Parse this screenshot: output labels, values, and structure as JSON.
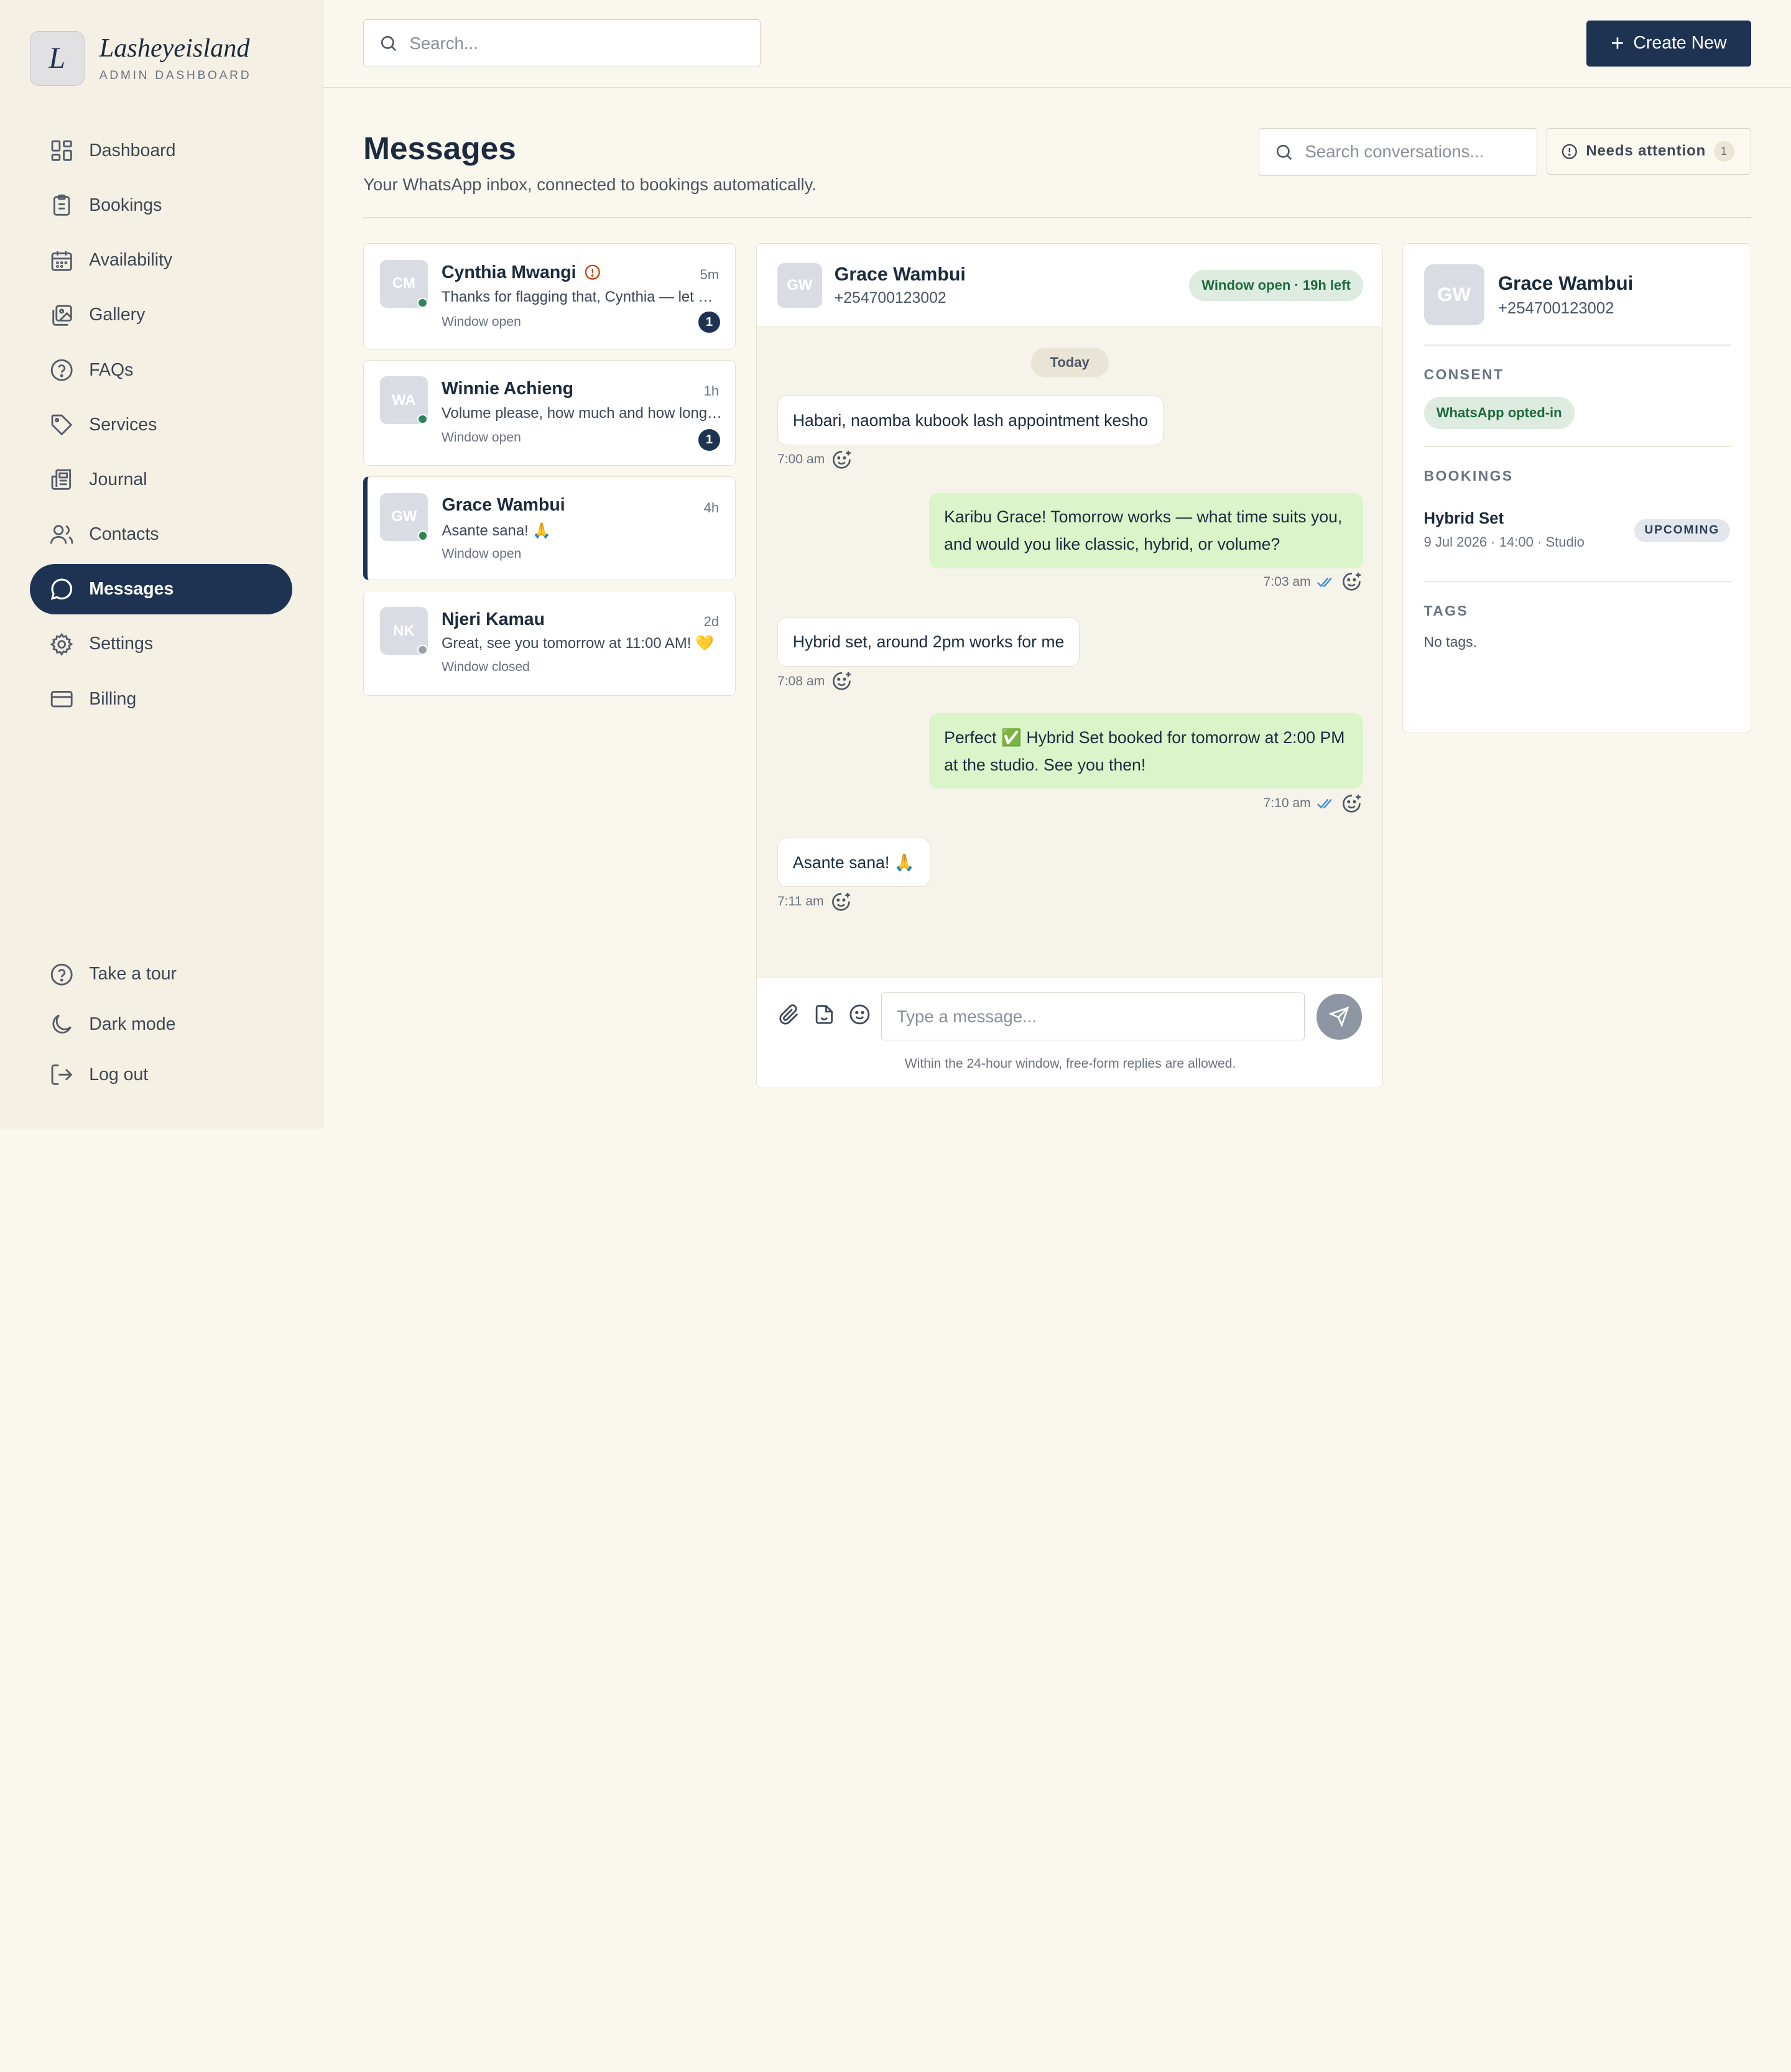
{
  "brand": {
    "logo_letter": "L",
    "name": "Lasheyeisland",
    "subtitle": "ADMIN DASHBOARD"
  },
  "nav": {
    "items": [
      {
        "label": "Dashboard",
        "icon": "grid-icon"
      },
      {
        "label": "Bookings",
        "icon": "clipboard-icon"
      },
      {
        "label": "Availability",
        "icon": "calendar-icon"
      },
      {
        "label": "Gallery",
        "icon": "image-icon"
      },
      {
        "label": "FAQs",
        "icon": "help-circle-icon"
      },
      {
        "label": "Services",
        "icon": "tag-icon"
      },
      {
        "label": "Journal",
        "icon": "newspaper-icon"
      },
      {
        "label": "Contacts",
        "icon": "users-icon"
      },
      {
        "label": "Messages",
        "icon": "chat-bubble-icon",
        "active": true
      },
      {
        "label": "Settings",
        "icon": "gear-icon"
      },
      {
        "label": "Billing",
        "icon": "credit-card-icon"
      }
    ],
    "bottom": [
      {
        "label": "Take a tour",
        "icon": "help-circle-icon"
      },
      {
        "label": "Dark mode",
        "icon": "moon-icon"
      },
      {
        "label": "Log out",
        "icon": "logout-icon"
      }
    ]
  },
  "topbar": {
    "search_placeholder": "Search...",
    "create_label": "Create New"
  },
  "header": {
    "title": "Messages",
    "subtitle": "Your WhatsApp inbox, connected to bookings automatically.",
    "conv_search_placeholder": "Search conversations...",
    "needs_attention_label": "Needs attention",
    "needs_attention_count": "1"
  },
  "conversations": [
    {
      "initials": "CM",
      "name": "Cynthia Mwangi",
      "time": "5m",
      "preview": "Thanks for flagging that, Cynthia — let me check and get back to you",
      "window": "Window open",
      "unread": "1",
      "status": "online",
      "flagged": true
    },
    {
      "initials": "WA",
      "name": "Winnie Achieng",
      "time": "1h",
      "preview": "Volume please, how much and how long does it take?",
      "window": "Window open",
      "unread": "1",
      "status": "online"
    },
    {
      "initials": "GW",
      "name": "Grace Wambui",
      "time": "4h",
      "preview": "Asante sana! 🙏",
      "window": "Window open",
      "status": "online",
      "active": true
    },
    {
      "initials": "NK",
      "name": "Njeri Kamau",
      "time": "2d",
      "preview": "Great, see you tomorrow at 11:00 AM! 💛",
      "window": "Window closed",
      "status": "offline"
    }
  ],
  "chat": {
    "initials": "GW",
    "name": "Grace Wambui",
    "phone": "+254700123002",
    "window_status": "Window open · 19h left",
    "day_label": "Today",
    "messages": [
      {
        "direction": "in",
        "text": "Habari, naomba kubook lash appointment kesho",
        "time": "7:00 am"
      },
      {
        "direction": "out",
        "text": "Karibu Grace! Tomorrow works — what time suits you, and would you like classic, hybrid, or volume?",
        "time": "7:03 am",
        "read": true
      },
      {
        "direction": "in",
        "text": "Hybrid set, around 2pm works for me",
        "time": "7:08 am"
      },
      {
        "direction": "out",
        "text": "Perfect ✅ Hybrid Set booked for tomorrow at 2:00 PM at the studio. See you then!",
        "time": "7:10 am",
        "read": true
      },
      {
        "direction": "in",
        "text": "Asante sana! 🙏",
        "time": "7:11 am"
      }
    ],
    "composer_placeholder": "Type a message...",
    "footer_note": "Within the 24-hour window, free-form replies are allowed."
  },
  "contact": {
    "initials": "GW",
    "name": "Grace Wambui",
    "phone": "+254700123002",
    "consent_label": "CONSENT",
    "consent_value": "WhatsApp opted-in",
    "bookings_label": "BOOKINGS",
    "booking": {
      "title": "Hybrid Set",
      "details": "9 Jul 2026 · 14:00 · Studio",
      "status": "UPCOMING"
    },
    "tags_label": "TAGS",
    "tags_value": "No tags."
  },
  "colors": {
    "primary": "#1e3352",
    "background": "#faf7ef",
    "sidebar": "#f5f0e4",
    "outgoing_bubble": "#d9f5c9",
    "online": "#2f855a",
    "offline": "#9aa0a6",
    "alert": "#c2410c"
  }
}
